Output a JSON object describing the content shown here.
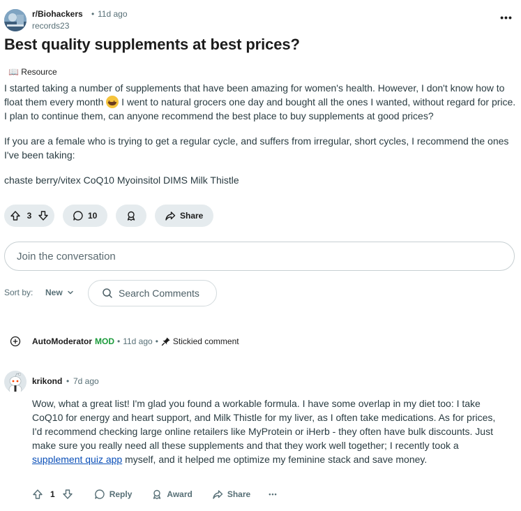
{
  "post": {
    "subreddit": "r/Biohackers",
    "dot": "•",
    "time": "11d ago",
    "author": "records23",
    "more": "•••",
    "title": "Best quality supplements at best prices?",
    "flair": "📖 Resource",
    "body_p1_a": "I started taking a number of supplements that have been amazing for women's health. However, I don't know how to float them every month",
    "body_p1_b": " I went to natural grocers one day and bought all the ones I wanted, without regard for price. I plan to continue them, can anyone recommend the best place to buy supplements at good prices?",
    "body_p2": "If you are a female who is trying to get a regular cycle, and suffers from irregular, short cycles, I recommend the ones I've been taking:",
    "body_p3": "chaste berry/vitex CoQ10 Myoinsitol DIMS Milk Thistle"
  },
  "actions": {
    "votes": "3",
    "comments": "10",
    "share": "Share"
  },
  "join": {
    "placeholder": "Join the conversation"
  },
  "sort": {
    "label": "Sort by:",
    "value": "New",
    "search_placeholder": "Search Comments"
  },
  "automod": {
    "name": "AutoModerator",
    "badge": "MOD",
    "sep": "•",
    "time": "11d ago",
    "sticky": "Stickied comment"
  },
  "comment": {
    "author": "krikond",
    "dot": "•",
    "time": "7d ago",
    "body_a": "Wow, what a great list! I'm glad you found a workable formula. I have some overlap in my diet too: I take CoQ10 for energy and heart support, and Milk Thistle for my liver, as I often take medications. As for prices, I'd recommend checking large online retailers like MyProtein or iHerb - they often have bulk discounts. Just make sure you really need all these supplements and that they work well together; I recently took a ",
    "link": "supplement quiz app",
    "body_b": " myself, and it helped me optimize my feminine stack and save money.",
    "votes": "1",
    "reply": "Reply",
    "award": "Award",
    "share": "Share",
    "more": "•••"
  },
  "colors": {
    "mod_green": "#1b9b3b",
    "link_blue": "#0a4fb8",
    "pill_bg": "#e5ebee"
  }
}
